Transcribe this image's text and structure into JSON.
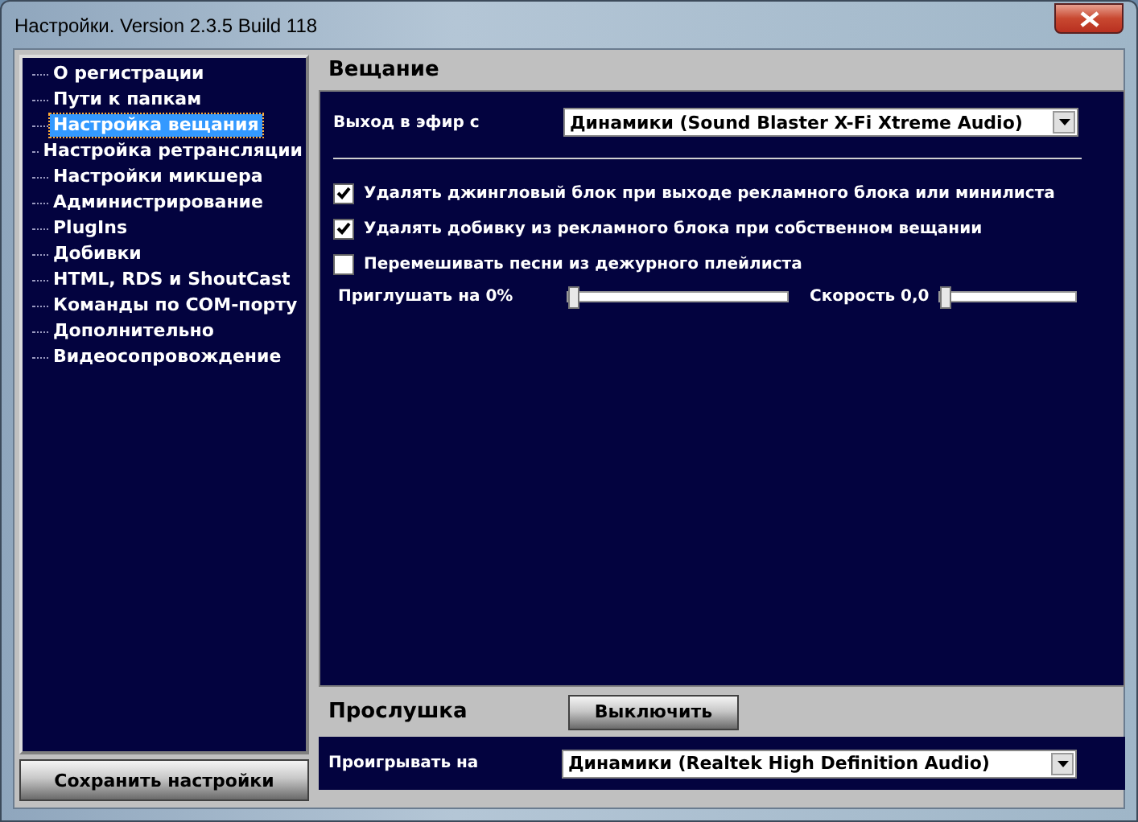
{
  "window": {
    "title": "Настройки. Version 2.3.5 Build 118"
  },
  "sidebar": {
    "items": [
      {
        "label": "О регистрации",
        "selected": false
      },
      {
        "label": "Пути к папкам",
        "selected": false
      },
      {
        "label": "Настройка вещания",
        "selected": true
      },
      {
        "label": "Настройка ретрансляции",
        "selected": false
      },
      {
        "label": "Настройки микшера",
        "selected": false
      },
      {
        "label": "Администрирование",
        "selected": false
      },
      {
        "label": "PlugIns",
        "selected": false
      },
      {
        "label": "Добивки",
        "selected": false
      },
      {
        "label": "HTML, RDS и ShoutCast",
        "selected": false
      },
      {
        "label": "Команды по COM-порту",
        "selected": false
      },
      {
        "label": "Дополнительно",
        "selected": false
      },
      {
        "label": "Видеосопровождение",
        "selected": false
      }
    ]
  },
  "save_button": "Сохранить настройки",
  "broadcast": {
    "title": "Вещание",
    "output_label": "Выход в эфир с",
    "output_value": "Динамики (Sound Blaster X-Fi Xtreme Audio)",
    "options": [
      {
        "label": "Удалять джингловый блок при выходе рекламного блока или минилиста",
        "checked": true
      },
      {
        "label": "Удалять добивку из рекламного блока при собственном вещании",
        "checked": true
      },
      {
        "label": "Перемешивать песни из дежурного плейлиста",
        "checked": false
      }
    ],
    "sliders": [
      {
        "label": "Приглушать на 0%",
        "level": 0
      },
      {
        "label": "Скорость 0,0",
        "level": 0
      }
    ]
  },
  "monitor": {
    "title": "Прослушка",
    "button": "Выключить",
    "play_label": "Проигрывать на",
    "play_value": "Динамики (Realtek High Definition Audio)"
  }
}
